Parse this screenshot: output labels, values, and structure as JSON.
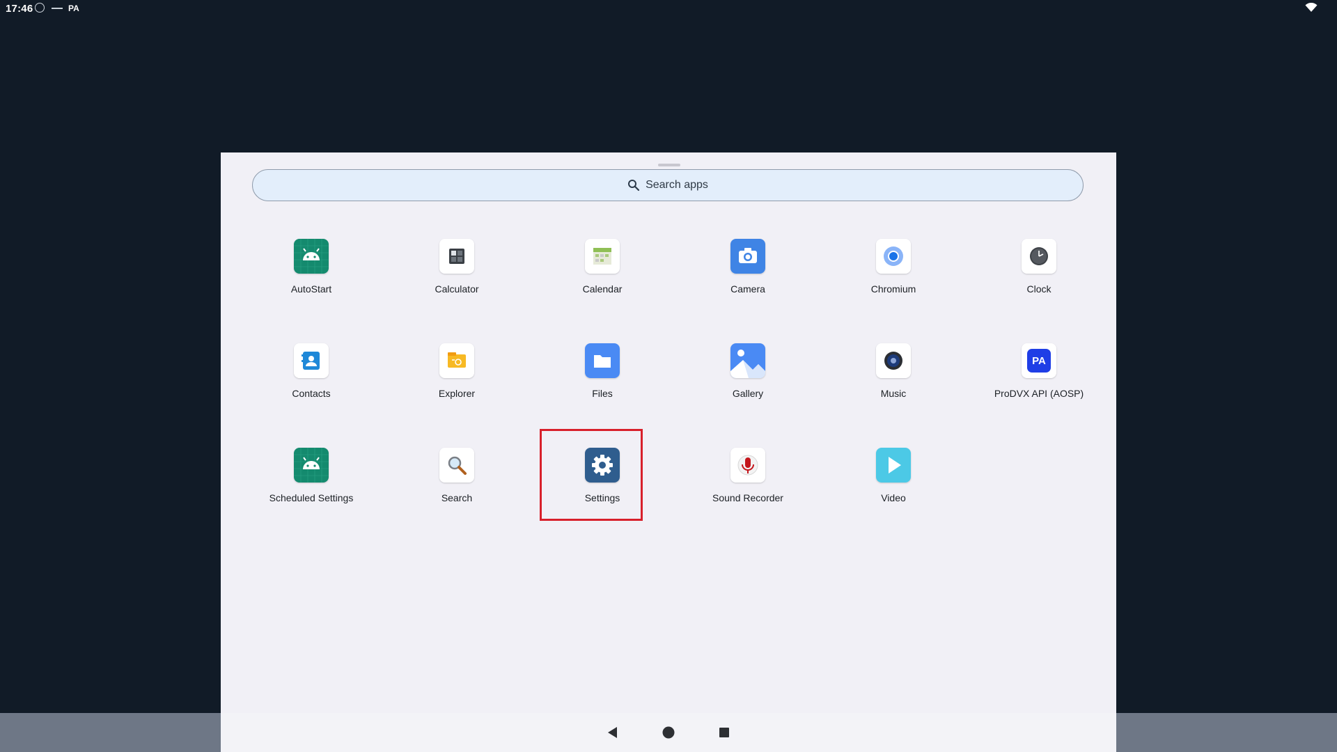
{
  "status_bar": {
    "time": "17:46",
    "carrier_label": "PA"
  },
  "search": {
    "placeholder": "Search apps"
  },
  "apps": [
    {
      "label": "AutoStart",
      "icon": "android-icon",
      "color": "#148a6e"
    },
    {
      "label": "Calculator",
      "icon": "calculator-icon",
      "color": "#ffffff"
    },
    {
      "label": "Calendar",
      "icon": "calendar-icon",
      "color": "#ffffff"
    },
    {
      "label": "Camera",
      "icon": "camera-icon",
      "color": "#3f84e5"
    },
    {
      "label": "Chromium",
      "icon": "chromium-icon",
      "color": "#ffffff"
    },
    {
      "label": "Clock",
      "icon": "clock-icon",
      "color": "#ffffff"
    },
    {
      "label": "Contacts",
      "icon": "contacts-icon",
      "color": "#ffffff"
    },
    {
      "label": "Explorer",
      "icon": "explorer-icon",
      "color": "#ffffff"
    },
    {
      "label": "Files",
      "icon": "files-icon",
      "color": "#4a8af4"
    },
    {
      "label": "Gallery",
      "icon": "gallery-icon",
      "color": "#4a8af4"
    },
    {
      "label": "Music",
      "icon": "music-icon",
      "color": "#ffffff"
    },
    {
      "label": "ProDVX API (AOSP)",
      "icon": "prodvx-api-icon",
      "color": "#ffffff",
      "badge_text": "PA"
    },
    {
      "label": "Scheduled Settings",
      "icon": "android-icon",
      "color": "#148a6e"
    },
    {
      "label": "Search",
      "icon": "magnifier-icon",
      "color": "#ffffff"
    },
    {
      "label": "Settings",
      "icon": "gear-icon",
      "color": "#2f5d8e"
    },
    {
      "label": "Sound Recorder",
      "icon": "microphone-icon",
      "color": "#ffffff"
    },
    {
      "label": "Video",
      "icon": "play-icon",
      "color": "#4cc9e6"
    }
  ],
  "highlighted_app": "Settings",
  "colors": {
    "background": "#111b27",
    "drawer": "#f1f0f6",
    "highlight": "#d8202b",
    "nav_bar": "#6e7786"
  }
}
